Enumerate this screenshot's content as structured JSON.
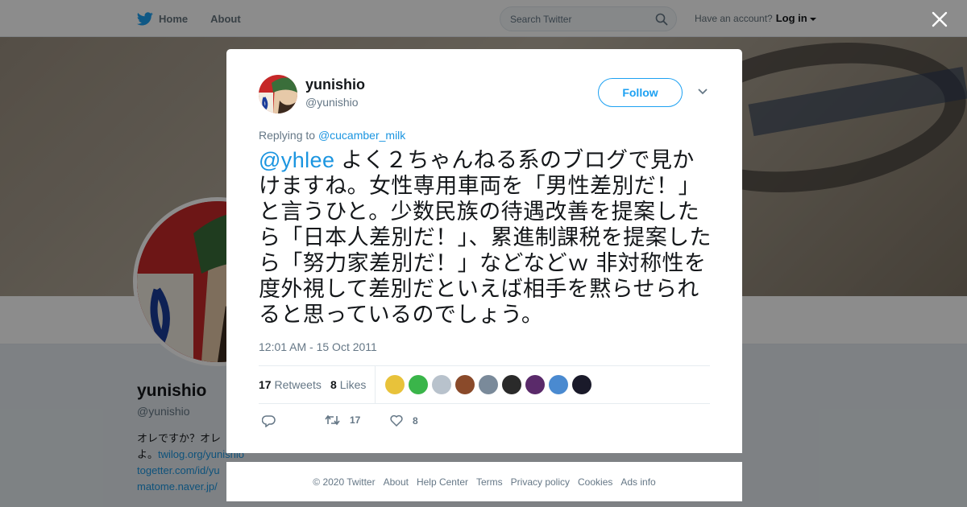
{
  "nav": {
    "home_label": "Home",
    "about_label": "About",
    "search_placeholder": "Search Twitter",
    "have_account": "Have an account?",
    "login_label": "Log in"
  },
  "profile": {
    "name": "yunishio",
    "handle": "@yunishio",
    "bio_line1": "オレですか？オレ",
    "bio_line2_prefix": "よ。",
    "bio_link1": "twilog.org/yunishio",
    "bio_link2": "togetter.com/id/yu",
    "bio_link3": "matome.naver.jp/"
  },
  "tweet": {
    "author_name": "yunishio",
    "author_handle": "@yunishio",
    "follow_label": "Follow",
    "replying_label": "Replying to",
    "replying_to": "@cucamber_milk",
    "mention": "@yhlee",
    "body": " よく２ちゃんねる系のブログで見かけますね。女性専用車両を「男性差別だ！」と言うひと。少数民族の待遇改善を提案したら「日本人差別だ！」、累進制課税を提案したら「努力家差別だ！」などなどｗ 非対称性を度外視して差別だといえば相手を黙らせられると思っているのでしょう。",
    "timestamp": "12:01 AM - 15 Oct 2011",
    "retweets_count": "17",
    "retweets_label": "Retweets",
    "likes_count": "8",
    "likes_label": "Likes",
    "retweet_action_count": "17",
    "like_action_count": "8",
    "likers": [
      {
        "color": "#e8c23a"
      },
      {
        "color": "#3ab54a"
      },
      {
        "color": "#b8c2cc"
      },
      {
        "color": "#8a4a2a"
      },
      {
        "color": "#7a8a9a"
      },
      {
        "color": "#2a2a2a"
      },
      {
        "color": "#5a2a6a"
      },
      {
        "color": "#4a8ad0"
      },
      {
        "color": "#1a1a2a"
      }
    ]
  },
  "footer": {
    "copyright": "© 2020 Twitter",
    "links": [
      "About",
      "Help Center",
      "Terms",
      "Privacy policy",
      "Cookies",
      "Ads info"
    ]
  },
  "colors": {
    "accent": "#1da1f2",
    "link": "#1b95e0"
  },
  "icons": {
    "logo": "twitter-bird-icon",
    "search": "search-icon",
    "close": "close-icon",
    "more": "chevron-down-icon",
    "reply": "reply-icon",
    "retweet": "retweet-icon",
    "like": "heart-icon"
  }
}
